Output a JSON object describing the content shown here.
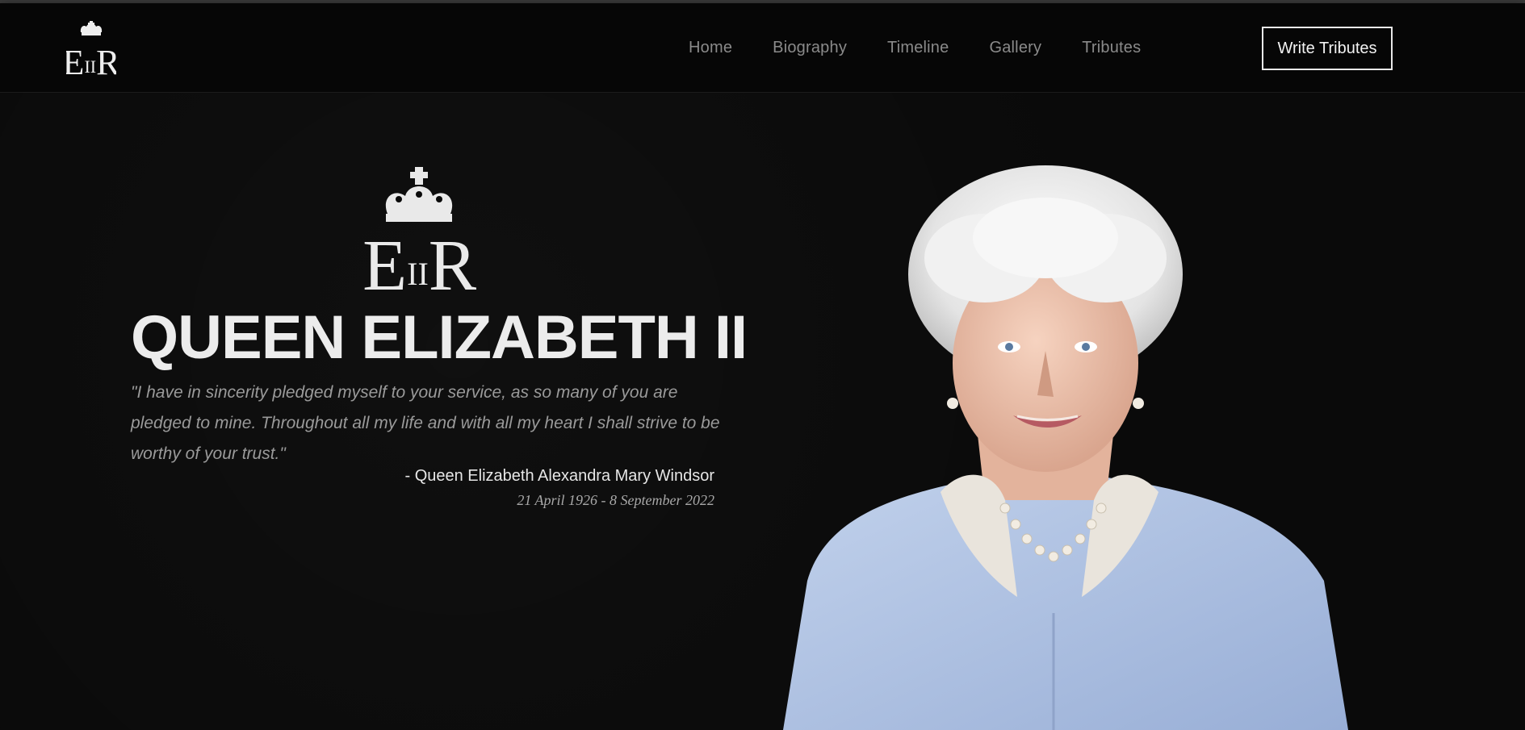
{
  "nav": {
    "logo_text": "EIIR",
    "links": [
      "Home",
      "Biography",
      "Timeline",
      "Gallery",
      "Tributes"
    ],
    "cta_label": "Write Tributes"
  },
  "hero": {
    "crest_text": "EIIR",
    "title": "QUEEN ELIZABETH II",
    "quote": "\"I have in sincerity pledged myself to your service, as so many of you are pledged to mine. Throughout all my life and with all my heart I shall strive to be worthy of your trust.\"",
    "attribution": "- Queen Elizabeth Alexandra Mary Windsor",
    "dates": "21 April 1926 - 8 September 2022"
  },
  "colors": {
    "background": "#0a0a0a",
    "text_primary": "#ececec",
    "text_muted": "#9a9a9a",
    "nav_link": "#8a8a8a",
    "outfit_blue": "#aec0e0"
  },
  "icons": [
    "crown-icon",
    "royal-cypher-icon"
  ]
}
